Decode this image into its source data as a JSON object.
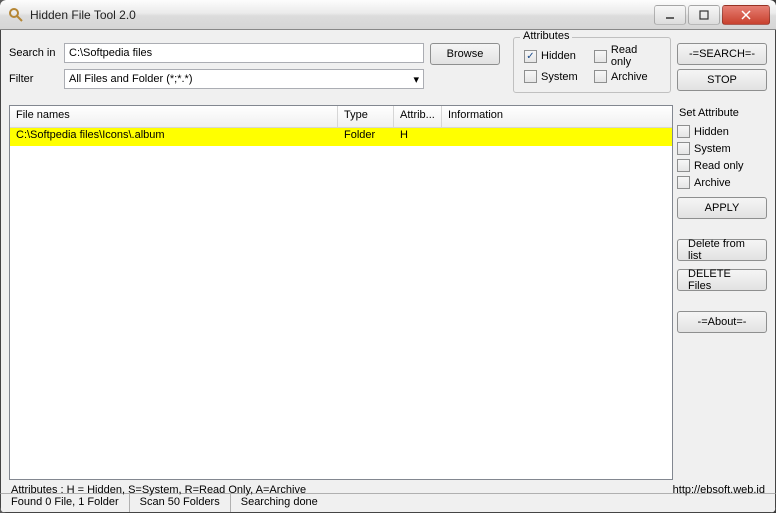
{
  "window": {
    "title": "Hidden File Tool 2.0"
  },
  "search": {
    "label_search_in": "Search in",
    "path": "C:\\Softpedia files",
    "label_filter": "Filter",
    "filter_value": "All Files and Folder (*;*.*)",
    "browse": "Browse"
  },
  "attributes": {
    "legend": "Attributes",
    "hidden": "Hidden",
    "system": "System",
    "readonly": "Read only",
    "archive": "Archive",
    "hidden_checked": "✓"
  },
  "actions": {
    "search_btn": "-=SEARCH=-",
    "stop_btn": "STOP"
  },
  "table": {
    "header": {
      "file_names": "File names",
      "type": "Type",
      "attrib": "Attrib...",
      "information": "Information"
    },
    "rows": [
      {
        "name": "C:\\Softpedia files\\Icons\\.album",
        "type": "Folder",
        "attrib": "H",
        "info": ""
      }
    ]
  },
  "right": {
    "set_attr": "Set Attribute",
    "hidden": "Hidden",
    "system": "System",
    "readonly": "Read only",
    "archive": "Archive",
    "apply": "APPLY",
    "delete_list": "Delete from list",
    "delete_files": "DELETE Files",
    "about": "-=About=-"
  },
  "footer": {
    "legend": "Attributes : H = Hidden, S=System, R=Read Only, A=Archive",
    "url": "http://ebsoft.web.id"
  },
  "status": {
    "found": "Found 0 File, 1 Folder",
    "scan": "Scan 50 Folders",
    "state": "Searching done"
  }
}
